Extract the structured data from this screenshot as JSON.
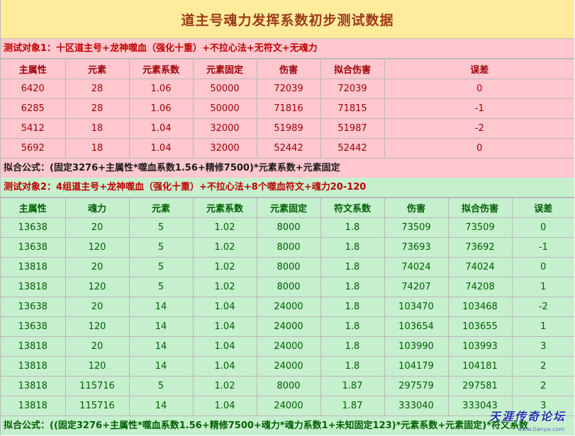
{
  "title": "道主号魂力发挥系数初步测试数据",
  "section1": {
    "subject": "测试对象1：十区道主号+龙神噬血（强化十重）+不拉心法+无符文+无魂力",
    "headers": [
      "主属性",
      "元素",
      "元素系数",
      "元素固定",
      "伤害",
      "拟合伤害",
      "误差"
    ],
    "rows": [
      [
        "6420",
        "28",
        "1.06",
        "50000",
        "72039",
        "72039",
        "0"
      ],
      [
        "6285",
        "28",
        "1.06",
        "50000",
        "71816",
        "71815",
        "-1"
      ],
      [
        "5412",
        "18",
        "1.04",
        "32000",
        "51989",
        "51987",
        "-2"
      ],
      [
        "5692",
        "18",
        "1.04",
        "32000",
        "52442",
        "52442",
        "0"
      ]
    ],
    "formula": "拟合公式：(固定3276+主属性*噬血系数1.56+精修7500)*元素系数+元素固定"
  },
  "section2": {
    "subject": "测试对象2：4组道主号+龙神噬血（强化十重）+不拉心法+8个噬血符文+魂力20-120",
    "headers": [
      "主属性",
      "魂力",
      "元素",
      "元素系数",
      "元素固定",
      "符文系数",
      "伤害",
      "拟合伤害",
      "误差"
    ],
    "rows": [
      [
        "13638",
        "20",
        "5",
        "1.02",
        "8000",
        "1.8",
        "73509",
        "73509",
        "0"
      ],
      [
        "13638",
        "120",
        "5",
        "1.02",
        "8000",
        "1.8",
        "73693",
        "73692",
        "-1"
      ],
      [
        "13818",
        "20",
        "5",
        "1.02",
        "8000",
        "1.8",
        "74024",
        "74024",
        "0"
      ],
      [
        "13818",
        "120",
        "5",
        "1.02",
        "8000",
        "1.8",
        "74207",
        "74208",
        "1"
      ],
      [
        "13638",
        "20",
        "14",
        "1.04",
        "24000",
        "1.8",
        "103470",
        "103468",
        "-2"
      ],
      [
        "13638",
        "120",
        "14",
        "1.04",
        "24000",
        "1.8",
        "103654",
        "103655",
        "1"
      ],
      [
        "13818",
        "20",
        "14",
        "1.04",
        "24000",
        "1.8",
        "103990",
        "103993",
        "3"
      ],
      [
        "13818",
        "120",
        "14",
        "1.04",
        "24000",
        "1.8",
        "104179",
        "104181",
        "2"
      ],
      [
        "13818",
        "115716",
        "5",
        "1.02",
        "8000",
        "1.87",
        "297579",
        "297581",
        "2"
      ],
      [
        "13818",
        "115716",
        "14",
        "1.04",
        "24000",
        "1.87",
        "333040",
        "333043",
        "3"
      ]
    ],
    "formula": "拟合公式：((固定3276+主属性*噬血系数1.56+精修7500+魂力*魂力系数1+未知固定123)*元素系数+元素固定)*符文系数"
  },
  "watermark": {
    "text": "天涯传奇论坛",
    "sub": "www.tianya.com"
  },
  "colors": {
    "title_bg": "#ffeb9c",
    "title_text": "#9c3a1a",
    "pink_bg": "#ffc7ce",
    "pink_text": "#9c0006",
    "green_bg": "#c6efce",
    "green_text": "#006100",
    "subject_text": "#c00000",
    "watermark": "#2236a8"
  }
}
